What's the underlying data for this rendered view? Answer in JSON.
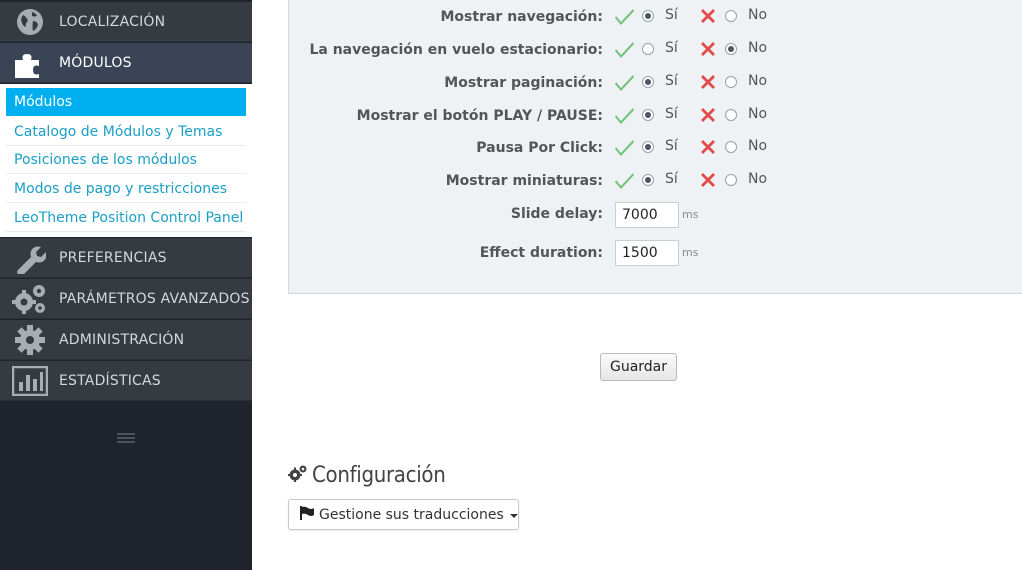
{
  "sidebar": {
    "items_top": [
      {
        "label": "LOCALIZACIÓN",
        "icon": "globe-icon"
      },
      {
        "label": "MÓDULOS",
        "icon": "puzzle-icon"
      }
    ],
    "submenu": [
      {
        "label": "Módulos"
      },
      {
        "label": "Catalogo de Módulos y Temas"
      },
      {
        "label": "Posiciones de los módulos"
      },
      {
        "label": "Modos de pago y restricciones"
      },
      {
        "label": "LeoTheme Position Control Panel"
      }
    ],
    "items_bottom": [
      {
        "label": "PREFERENCIAS",
        "icon": "wrench-icon"
      },
      {
        "label": "PARÁMETROS AVANZADOS",
        "icon": "gears-icon"
      },
      {
        "label": "ADMINISTRACIÓN",
        "icon": "gear-icon"
      },
      {
        "label": "ESTADÍSTICAS",
        "icon": "bar-chart-icon"
      }
    ]
  },
  "form": {
    "yes_label": "Sí",
    "no_label": "No",
    "rows": [
      {
        "label": "Mostrar navegación:",
        "selected": "yes"
      },
      {
        "label": "La navegación en vuelo estacionario:",
        "selected": "no"
      },
      {
        "label": "Mostrar paginación:",
        "selected": "yes"
      },
      {
        "label": "Mostrar el botón PLAY / PAUSE:",
        "selected": "yes"
      },
      {
        "label": "Pausa Por Click:",
        "selected": "yes"
      },
      {
        "label": "Mostrar miniaturas:",
        "selected": "yes"
      }
    ],
    "slide_delay": {
      "label": "Slide delay:",
      "value": "7000",
      "unit": "ms"
    },
    "effect_duration": {
      "label": "Effect duration:",
      "value": "1500",
      "unit": "ms"
    }
  },
  "save_label": "Guardar",
  "config": {
    "title": "Configuración",
    "translate_label": "Gestione sus traducciones"
  },
  "colors": {
    "sidebar_bg": "#1f232b",
    "nav_item_bg": "#363a41",
    "active_submenu": "#00aff0",
    "link": "#1a9ec6",
    "check": "#72c279",
    "cross": "#e24c4b"
  }
}
